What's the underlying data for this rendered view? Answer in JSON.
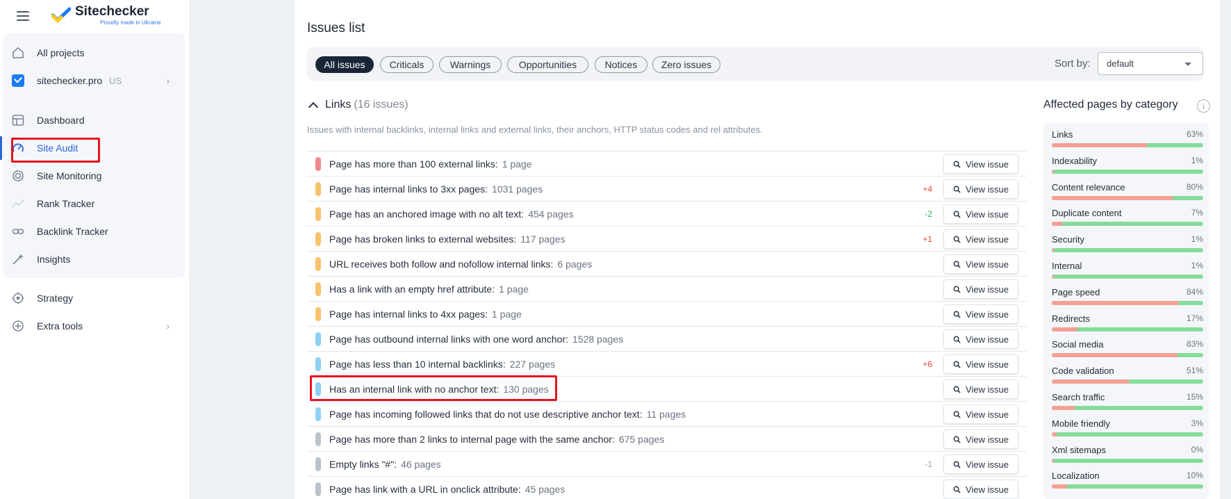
{
  "logo": {
    "title": "Sitechecker",
    "subtitle": "Proudly made in Ukraine"
  },
  "sidebar": {
    "all_projects": "All projects",
    "project": {
      "name": "sitechecker.pro",
      "region": "US"
    },
    "items": [
      {
        "label": "Dashboard",
        "icon": "dashboard-icon"
      },
      {
        "label": "Site Audit",
        "icon": "gauge-icon",
        "active": true
      },
      {
        "label": "Site Monitoring",
        "icon": "monitoring-icon"
      },
      {
        "label": "Rank Tracker",
        "icon": "trend-icon"
      },
      {
        "label": "Backlink Tracker",
        "icon": "link-icon"
      },
      {
        "label": "Insights",
        "icon": "magic-wand-icon"
      }
    ],
    "strategy": "Strategy",
    "extra_tools": "Extra tools"
  },
  "main": {
    "title": "Issues list",
    "filters": [
      "All issues",
      "Criticals",
      "Warnings",
      "Opportunities",
      "Notices",
      "Zero issues"
    ],
    "active_filter": "All issues",
    "sort_label": "Sort by:",
    "sort_value": "default",
    "section": {
      "title": "Links",
      "count": "(16 issues)",
      "description": "Issues with internal backlinks, internal links and external links, their anchors, HTTP status codes and rel attributes."
    },
    "view_issue_label": "View issue",
    "severity_colors": {
      "critical": "#f28b8b",
      "warning": "#f9c26e",
      "opportunity": "#8fd0f5",
      "notice": "#bcc3cc"
    },
    "issues": [
      {
        "text": "Page has more than 100 external links:",
        "pages": "1 page",
        "severity": "critical",
        "delta": ""
      },
      {
        "text": "Page has internal links to 3xx pages:",
        "pages": "1031 pages",
        "severity": "warning",
        "delta": "+4"
      },
      {
        "text": "Page has an anchored image with no alt text:",
        "pages": "454 pages",
        "severity": "warning",
        "delta": "-2"
      },
      {
        "text": "Page has broken links to external websites:",
        "pages": "117 pages",
        "severity": "warning",
        "delta": "+1"
      },
      {
        "text": "URL receives both follow and nofollow internal links:",
        "pages": "6 pages",
        "severity": "warning",
        "delta": ""
      },
      {
        "text": "Has a link with an empty href attribute:",
        "pages": "1 page",
        "severity": "warning",
        "delta": ""
      },
      {
        "text": "Page has internal links to 4xx pages:",
        "pages": "1 page",
        "severity": "warning",
        "delta": ""
      },
      {
        "text": "Page has outbound internal links with one word anchor:",
        "pages": "1528 pages",
        "severity": "opportunity",
        "delta": ""
      },
      {
        "text": "Page has less than 10 internal backlinks:",
        "pages": "227 pages",
        "severity": "opportunity",
        "delta": "+6"
      },
      {
        "text": "Has an internal link with no anchor text:",
        "pages": "130 pages",
        "severity": "opportunity",
        "delta": ""
      },
      {
        "text": "Page has incoming followed links that do not use descriptive anchor text:",
        "pages": "11 pages",
        "severity": "opportunity",
        "delta": ""
      },
      {
        "text": "Page has more than 2 links to internal page with the same anchor:",
        "pages": "675 pages",
        "severity": "notice",
        "delta": ""
      },
      {
        "text": "Empty links \"#\":",
        "pages": "46 pages",
        "severity": "notice",
        "delta": "-1"
      },
      {
        "text": "Page has link with a URL in onclick attribute:",
        "pages": "45 pages",
        "severity": "notice",
        "delta": ""
      }
    ]
  },
  "affected": {
    "title": "Affected pages by category",
    "bar_colors": {
      "affected": "#f4a193",
      "ok": "#86dc9b"
    },
    "categories": [
      {
        "name": "Links",
        "pct": "63%",
        "value": 63
      },
      {
        "name": "Indexability",
        "pct": "1%",
        "value": 1
      },
      {
        "name": "Content relevance",
        "pct": "80%",
        "value": 80
      },
      {
        "name": "Duplicate content",
        "pct": "7%",
        "value": 7
      },
      {
        "name": "Security",
        "pct": "1%",
        "value": 1
      },
      {
        "name": "Internal",
        "pct": "1%",
        "value": 1
      },
      {
        "name": "Page speed",
        "pct": "84%",
        "value": 84
      },
      {
        "name": "Redirects",
        "pct": "17%",
        "value": 17
      },
      {
        "name": "Social media",
        "pct": "83%",
        "value": 83
      },
      {
        "name": "Code validation",
        "pct": "51%",
        "value": 51
      },
      {
        "name": "Search traffic",
        "pct": "15%",
        "value": 15
      },
      {
        "name": "Mobile friendly",
        "pct": "3%",
        "value": 3
      },
      {
        "name": "Xml sitemaps",
        "pct": "0%",
        "value": 0
      },
      {
        "name": "Localization",
        "pct": "10%",
        "value": 10
      }
    ]
  }
}
